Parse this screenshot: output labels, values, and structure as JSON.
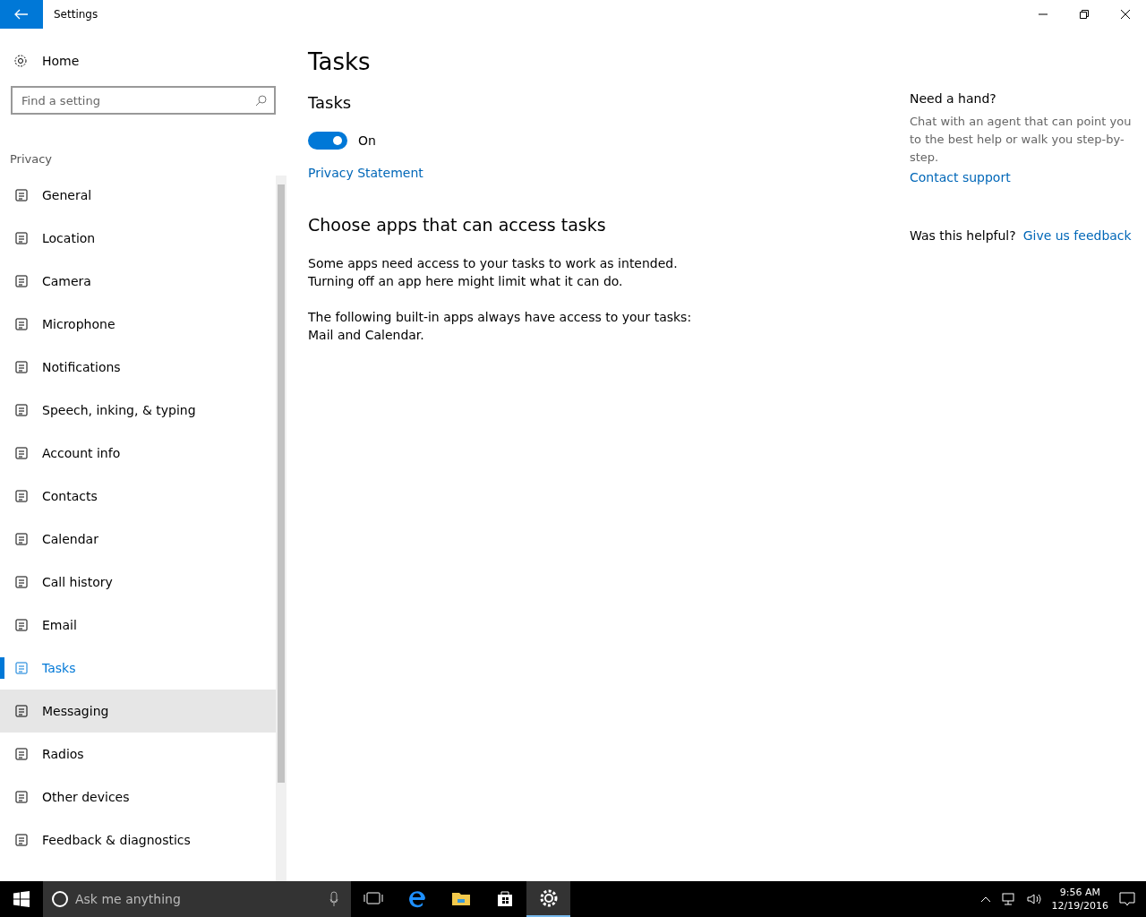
{
  "window": {
    "title": "Settings"
  },
  "sidebar": {
    "home": "Home",
    "search": {
      "placeholder": "Find a setting"
    },
    "section": "Privacy",
    "items": [
      {
        "label": "General",
        "selected": false,
        "hovered": false
      },
      {
        "label": "Location",
        "selected": false,
        "hovered": false
      },
      {
        "label": "Camera",
        "selected": false,
        "hovered": false
      },
      {
        "label": "Microphone",
        "selected": false,
        "hovered": false
      },
      {
        "label": "Notifications",
        "selected": false,
        "hovered": false
      },
      {
        "label": "Speech, inking, & typing",
        "selected": false,
        "hovered": false
      },
      {
        "label": "Account info",
        "selected": false,
        "hovered": false
      },
      {
        "label": "Contacts",
        "selected": false,
        "hovered": false
      },
      {
        "label": "Calendar",
        "selected": false,
        "hovered": false
      },
      {
        "label": "Call history",
        "selected": false,
        "hovered": false
      },
      {
        "label": "Email",
        "selected": false,
        "hovered": false
      },
      {
        "label": "Tasks",
        "selected": true,
        "hovered": false
      },
      {
        "label": "Messaging",
        "selected": false,
        "hovered": true
      },
      {
        "label": "Radios",
        "selected": false,
        "hovered": false
      },
      {
        "label": "Other devices",
        "selected": false,
        "hovered": false
      },
      {
        "label": "Feedback & diagnostics",
        "selected": false,
        "hovered": false
      }
    ]
  },
  "main": {
    "title": "Tasks",
    "subtitle": "Tasks",
    "toggle": {
      "on": true,
      "label": "On"
    },
    "link": "Privacy Statement",
    "heading": "Choose apps that can access tasks",
    "paragraphs": [
      "Some apps need access to your tasks to work as intended. Turning off an app here might limit what it can do.",
      "The following built-in apps always have access to your tasks: Mail and Calendar."
    ]
  },
  "help": {
    "title": "Need a hand?",
    "text": "Chat with an agent that can point you to the best help or walk you step-by-step.",
    "link": "Contact support",
    "question": "Was this helpful?",
    "feedback": "Give us feedback"
  },
  "taskbar": {
    "search": {
      "placeholder": "Ask me anything"
    },
    "apps": [
      {
        "selected": false
      },
      {
        "selected": false
      },
      {
        "selected": false
      },
      {
        "selected": false
      },
      {
        "selected": true
      }
    ],
    "time": "9:56 AM",
    "date": "12/19/2016"
  }
}
